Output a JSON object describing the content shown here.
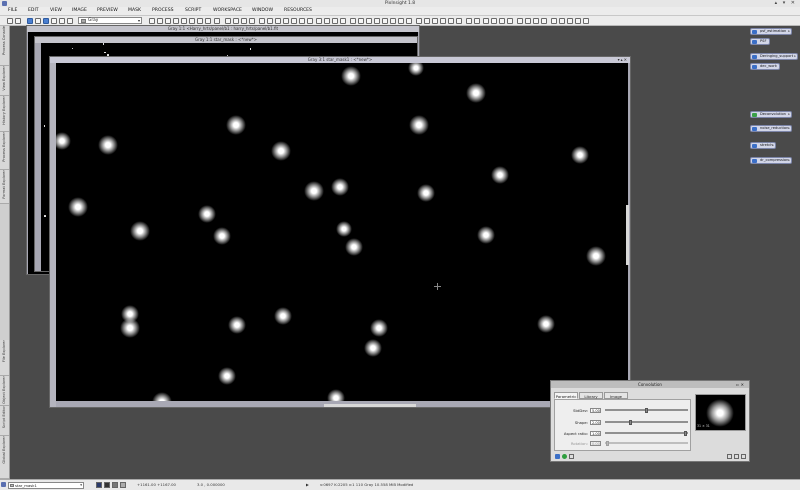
{
  "app": {
    "title": "PixInsight 1.8",
    "window_controls": "▴ ▾ ✕"
  },
  "menu": [
    "FILE",
    "EDIT",
    "VIEW",
    "IMAGE",
    "PREVIEW",
    "MASK",
    "PROCESS",
    "SCRIPT",
    "WORKSPACE",
    "WINDOW",
    "RESOURCES"
  ],
  "toolbar": {
    "view_select": "Gray"
  },
  "left_dock": {
    "tabs": [
      "Process Console",
      "View Explorer",
      "History Explorer",
      "Process Explorer",
      "Format Explorer",
      "File Explorer",
      "Object Explorer",
      "Script Editor",
      "Global Explorer"
    ]
  },
  "windows": {
    "back": {
      "title": "Gray 1:1 <Harry_hrts/panel/b1 : harry_hrts/panel/b1.fit"
    },
    "middle": {
      "title": "Gray 1:1 star_mask : <*new*>"
    },
    "front": {
      "title": "Gray 3:1 star_mask1 : <*new*>"
    }
  },
  "icons": [
    "psf_estimation",
    "PSF",
    "Deringing_support",
    "dec_work",
    "Deconvolution",
    "noise_reduction",
    "stretch",
    "dr_compression"
  ],
  "convolution": {
    "title": "Convolution",
    "tabs": [
      "Parametric",
      "Library",
      "Image"
    ],
    "params": [
      {
        "label": "StdDev:",
        "value": "5.00"
      },
      {
        "label": "Shape:",
        "value": "2.00"
      },
      {
        "label": "Aspect ratio:",
        "value": "1.00"
      },
      {
        "label": "Rotation:",
        "value": "0.00"
      }
    ],
    "slider_levels": [
      0.5,
      0.3,
      1.0,
      0.0
    ],
    "preview_size": "31 × 31"
  },
  "statusbar": {
    "view": "star_mask1",
    "coords": "+1161.00   +1167.00",
    "zoom": "3.0 ,  0.000000",
    "readout": "v:0697  K:2205  v:1  110  Gray  10.558 MiB  Modified"
  }
}
